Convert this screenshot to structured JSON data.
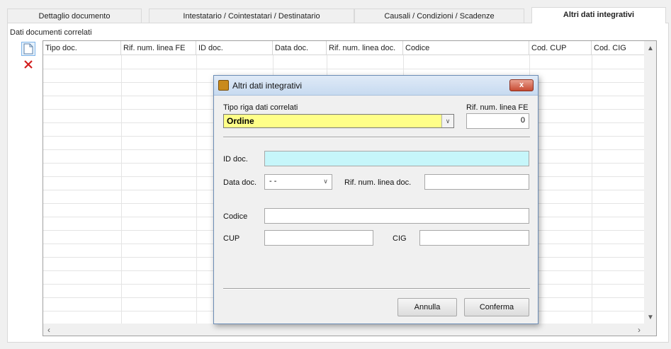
{
  "tabs": [
    {
      "label": "Dettaglio documento"
    },
    {
      "label": "Intestatario / Cointestatari / Destinatario"
    },
    {
      "label": "Causali / Condizioni / Scadenze"
    },
    {
      "label": "Altri dati integrativi"
    }
  ],
  "section": {
    "title": "Dati documenti correlati"
  },
  "grid": {
    "columns": [
      "Tipo doc.",
      "Rif. num. linea FE",
      "ID doc.",
      "Data doc.",
      "Rif. num. linea doc.",
      "Codice",
      "Cod. CUP",
      "Cod. CIG"
    ]
  },
  "toolbar": {
    "new_icon": "new-document-icon",
    "delete_icon": "delete-x-icon"
  },
  "dialog": {
    "title": "Altri dati integrativi",
    "close_label": "x",
    "tipo_riga_label": "Tipo riga dati correlati",
    "tipo_riga_value": "Ordine",
    "rif_fe_label": "Rif. num. linea FE",
    "rif_fe_value": "0",
    "id_doc_label": "ID doc.",
    "id_doc_value": "",
    "data_doc_label": "Data doc.",
    "data_doc_value": "- -",
    "rif_doc_label": "Rif. num. linea doc.",
    "rif_doc_value": "",
    "codice_label": "Codice",
    "codice_value": "",
    "cup_label": "CUP",
    "cup_value": "",
    "cig_label": "CIG",
    "cig_value": "",
    "cancel_label": "Annulla",
    "confirm_label": "Conferma"
  },
  "colors": {
    "highlight_yellow": "#ffff88",
    "id_field_cyan": "#c6f6fa",
    "close_red": "#c74b33"
  }
}
